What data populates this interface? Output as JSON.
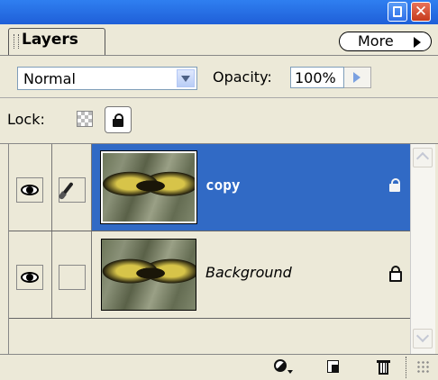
{
  "panel": {
    "tab_label": "Layers",
    "more_label": "More"
  },
  "options": {
    "blend_mode": "Normal",
    "opacity_label": "Opacity:",
    "opacity_value": "100%",
    "lock_label": "Lock:"
  },
  "layers": [
    {
      "name": "copy",
      "visible": true,
      "selected": true,
      "linked_brush": true,
      "locked": "full"
    },
    {
      "name": "Background",
      "visible": true,
      "selected": false,
      "linked_brush": false,
      "locked": "outline"
    }
  ],
  "colors": {
    "selection": "#316ac5",
    "panel_bg": "#ece9d8",
    "titlebar": "#2f7ff0"
  },
  "icons": {
    "eye": "eye-icon",
    "brush": "brush-icon",
    "adjustment": "adjustment-layer-icon",
    "new_layer": "new-layer-icon",
    "trash": "trash-icon"
  }
}
